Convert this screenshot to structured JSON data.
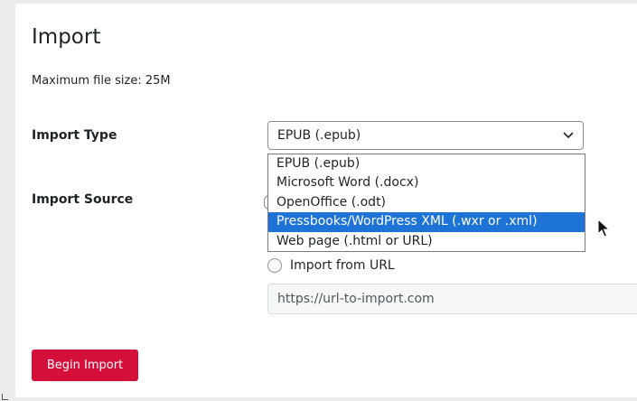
{
  "page": {
    "title": "Import",
    "max_file_size": "Maximum file size: 25M"
  },
  "import_type": {
    "label": "Import Type",
    "selected": "EPUB (.epub)",
    "options": [
      "EPUB (.epub)",
      "Microsoft Word (.docx)",
      "OpenOffice (.odt)",
      "Pressbooks/WordPress XML (.wxr or .xml)",
      "Web page (.html or URL)"
    ],
    "highlighted_index": 3,
    "chevron_icon": "chevron-down-icon"
  },
  "import_source": {
    "label": "Import Source",
    "url_option_label": "Import from URL",
    "url_placeholder": "https://url-to-import.com"
  },
  "actions": {
    "begin_import_label": "Begin Import"
  },
  "colors": {
    "accent": "#d40f3a",
    "highlight": "#1e73d6",
    "background": "#ececec"
  }
}
